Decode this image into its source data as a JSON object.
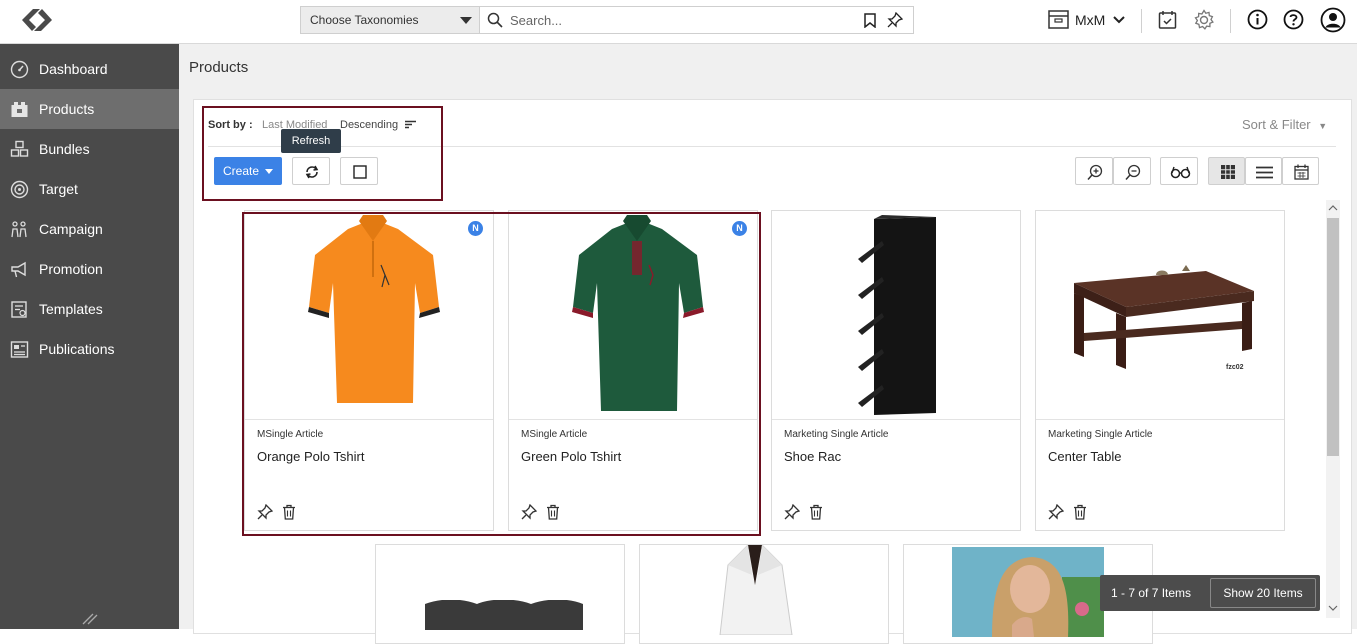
{
  "header": {
    "taxonomy_select": "Choose Taxonomies",
    "search_placeholder": "Search...",
    "workspace_label": "MxM"
  },
  "sidebar": {
    "items": [
      {
        "label": "Dashboard",
        "icon": "dashboard-icon"
      },
      {
        "label": "Products",
        "icon": "products-icon",
        "active": true
      },
      {
        "label": "Bundles",
        "icon": "bundles-icon"
      },
      {
        "label": "Target",
        "icon": "target-icon"
      },
      {
        "label": "Campaign",
        "icon": "campaign-icon"
      },
      {
        "label": "Promotion",
        "icon": "promotion-icon"
      },
      {
        "label": "Templates",
        "icon": "templates-icon"
      },
      {
        "label": "Publications",
        "icon": "publications-icon"
      }
    ]
  },
  "main": {
    "title": "Products",
    "sort": {
      "label": "Sort by :",
      "field": "Last Modified",
      "direction": "Descending"
    },
    "sort_filter": "Sort & Filter",
    "create_label": "Create",
    "tooltip": "Refresh"
  },
  "cards": [
    {
      "type": "MSingle Article",
      "name": "Orange Polo Tshirt",
      "badge": "N"
    },
    {
      "type": "MSingle Article",
      "name": "Green Polo Tshirt",
      "badge": "N"
    },
    {
      "type": "Marketing Single Article",
      "name": "Shoe Rac"
    },
    {
      "type": "Marketing Single Article",
      "name": "Center Table",
      "image_caption": "fzc02"
    }
  ],
  "pager": {
    "count": "1 - 7 of 7 Items",
    "show_button": "Show 20 Items"
  },
  "colors": {
    "accent": "#3b82e6",
    "sidebar": "#4a4a4a",
    "sidebar_active": "#6e6e6e",
    "highlight": "#6b1020"
  }
}
